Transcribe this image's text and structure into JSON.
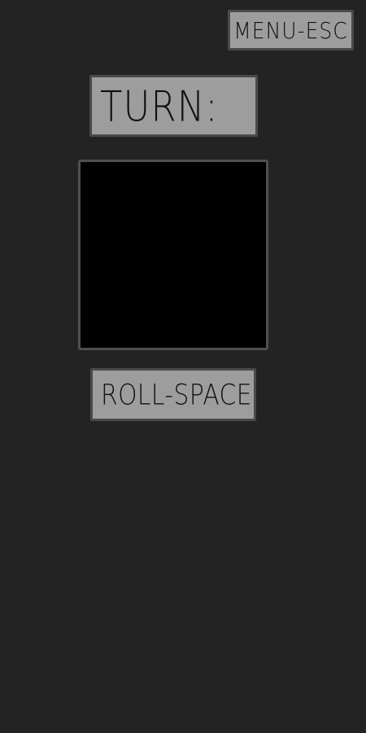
{
  "menu": {
    "label": "MENU-ESC"
  },
  "turn": {
    "label": "TURN:"
  },
  "roll": {
    "label": "ROLL-SPACE"
  },
  "colors": {
    "background": "#232323",
    "panel": "#9d9d9d",
    "panel_border": "#4a4a4a",
    "dice_area": "#000000"
  }
}
